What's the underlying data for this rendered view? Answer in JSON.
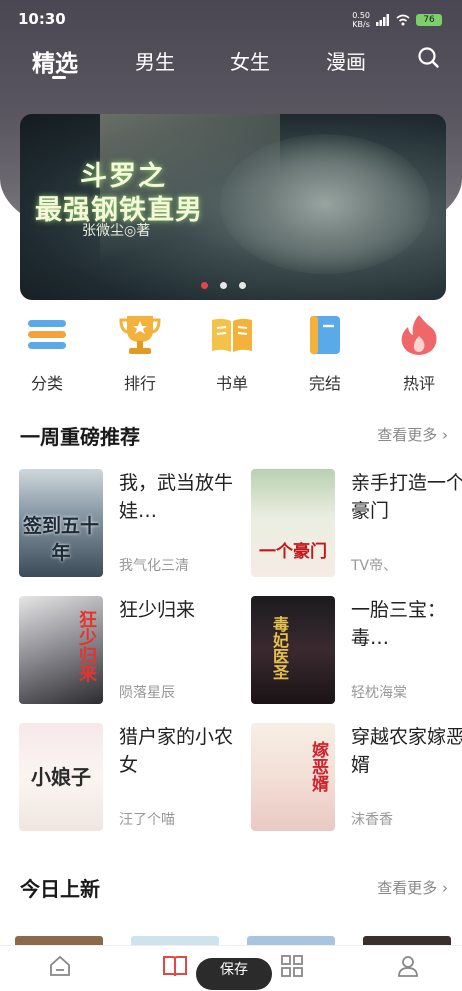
{
  "status_bar": {
    "time": "10:30",
    "net_speed": "0.50",
    "net_unit": "KB/s",
    "battery": "76"
  },
  "tabs": [
    {
      "label": "精选",
      "active": true
    },
    {
      "label": "男生",
      "active": false
    },
    {
      "label": "女生",
      "active": false
    },
    {
      "label": "漫画",
      "active": false
    }
  ],
  "banner": {
    "title_line1": "斗罗之",
    "title_line2": "最强钢铁直男",
    "author": "张微尘◎著"
  },
  "quick_nav": [
    {
      "label": "分类",
      "icon": "category-icon"
    },
    {
      "label": "排行",
      "icon": "trophy-icon"
    },
    {
      "label": "书单",
      "icon": "book-list-icon"
    },
    {
      "label": "完结",
      "icon": "finished-book-icon"
    },
    {
      "label": "热评",
      "icon": "flame-icon"
    }
  ],
  "weekly": {
    "title": "一周重磅推荐",
    "more": "查看更多",
    "books": [
      {
        "title": "我，武当放牛娃…",
        "author": "我气化三清",
        "cover_text": "签到五十年"
      },
      {
        "title": "亲手打造一个豪门",
        "author": "TV帝、",
        "cover_text": "一个豪门"
      },
      {
        "title": "狂少归来",
        "author": "陨落星辰",
        "cover_text": "狂少归来"
      },
      {
        "title": "一胎三宝：毒…",
        "author": "轻枕海棠",
        "cover_text": "毒妃医圣"
      },
      {
        "title": "猎户家的小农女",
        "author": "汪了个喵",
        "cover_text": "小娘子"
      },
      {
        "title": "穿越农家嫁恶婿",
        "author": "沫香香",
        "cover_text": "嫁恶婿"
      }
    ]
  },
  "today": {
    "title": "今日上新",
    "more": "查看更多"
  },
  "bottom_nav": {
    "save_label": "保存"
  },
  "colors": {
    "accent_red": "#e34848",
    "header_bg": "#55525b"
  }
}
